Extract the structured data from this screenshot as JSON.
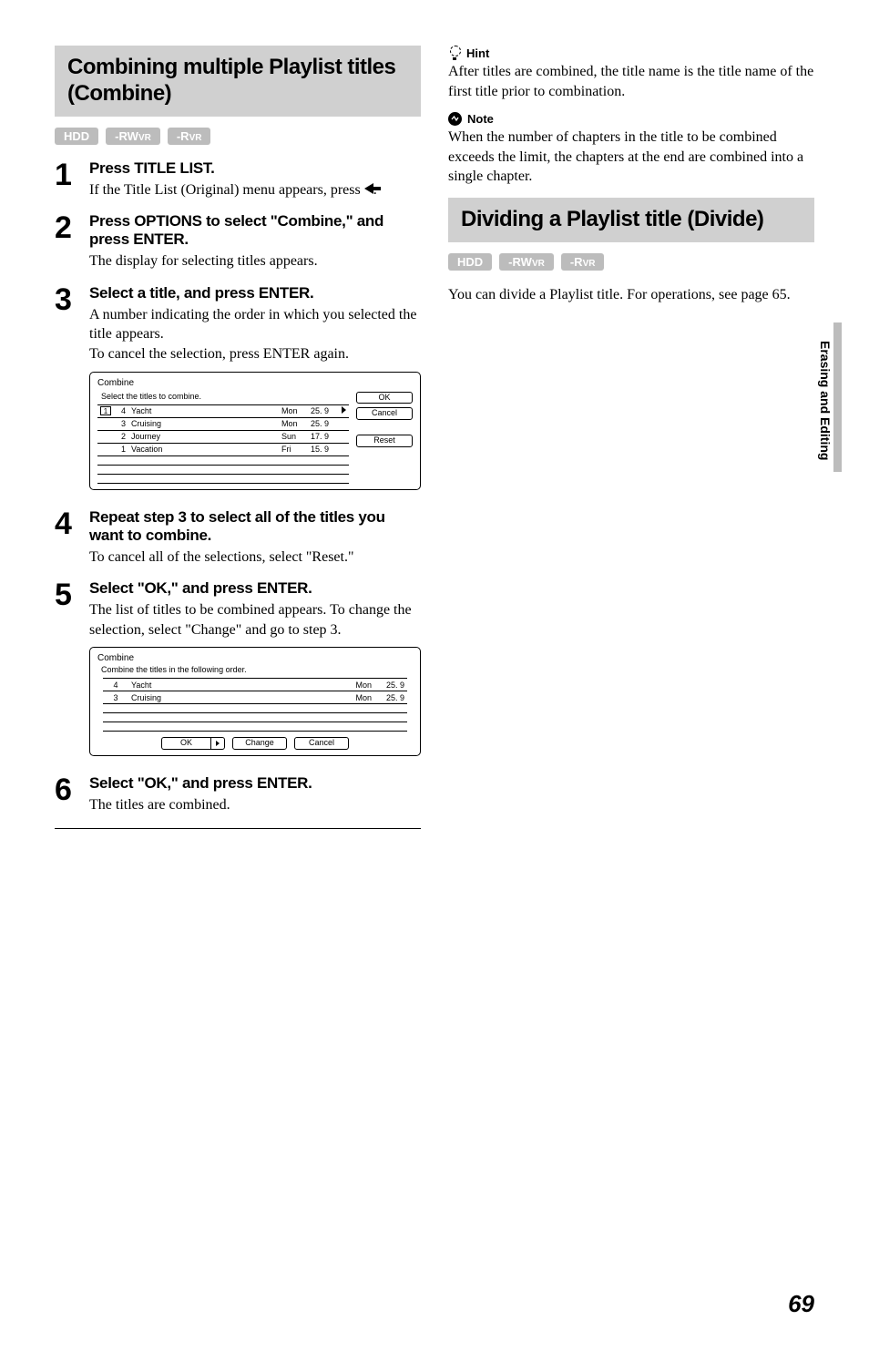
{
  "sideTab": "Erasing and Editing",
  "pageNumber": "69",
  "left": {
    "heading": "Combining multiple Playlist titles (Combine)",
    "badges": [
      {
        "main": "HDD",
        "sub": ""
      },
      {
        "main": "-RW",
        "sub": "VR"
      },
      {
        "main": "-R",
        "sub": "VR"
      }
    ],
    "steps": [
      {
        "num": "1",
        "title": "Press TITLE LIST.",
        "text_before": "If the Title List (Original) menu appears, press ",
        "text_after": "."
      },
      {
        "num": "2",
        "title": "Press OPTIONS to select \"Combine,\" and press ENTER.",
        "text": "The display for selecting titles appears."
      },
      {
        "num": "3",
        "title": "Select a title, and press ENTER.",
        "text": "A number indicating the order in which you selected the title appears.\nTo cancel the selection, press ENTER again."
      },
      {
        "num": "4",
        "title": "Repeat step 3 to select all of the titles you want to combine.",
        "text": "To cancel all of the selections, select \"Reset.\""
      },
      {
        "num": "5",
        "title": "Select \"OK,\" and press ENTER.",
        "text": "The list of titles to be combined appears. To change the selection, select \"Change\" and go to step 3."
      },
      {
        "num": "6",
        "title": "Select \"OK,\" and press ENTER.",
        "text": "The titles are combined."
      }
    ],
    "dialog1": {
      "title": "Combine",
      "sub": "Select the titles to combine.",
      "rows": [
        {
          "idx": "1",
          "no": "4",
          "name": "Yacht",
          "day": "Mon",
          "date": "25.  9",
          "arrow": true
        },
        {
          "idx": "",
          "no": "3",
          "name": "Cruising",
          "day": "Mon",
          "date": "25.  9",
          "arrow": false
        },
        {
          "idx": "",
          "no": "2",
          "name": "Journey",
          "day": "Sun",
          "date": "17.  9",
          "arrow": false
        },
        {
          "idx": "",
          "no": "1",
          "name": "Vacation",
          "day": "Fri",
          "date": "15.  9",
          "arrow": false
        }
      ],
      "buttons": [
        "OK",
        "Cancel",
        "Reset"
      ]
    },
    "dialog2": {
      "title": "Combine",
      "sub": "Combine the titles in the following order.",
      "rows": [
        {
          "no": "4",
          "name": "Yacht",
          "day": "Mon",
          "date": "25.  9"
        },
        {
          "no": "3",
          "name": "Cruising",
          "day": "Mon",
          "date": "25.  9"
        }
      ],
      "buttons": [
        "OK",
        "Change",
        "Cancel"
      ]
    }
  },
  "right": {
    "hintLabel": "Hint",
    "hintText": "After titles are combined, the title name is the title name of the first title prior to combination.",
    "noteLabel": "Note",
    "noteText": "When the number of chapters in the title to be combined exceeds the limit, the chapters at the end are combined into a single chapter.",
    "heading2": "Dividing a Playlist title (Divide)",
    "badges": [
      {
        "main": "HDD",
        "sub": ""
      },
      {
        "main": "-RW",
        "sub": "VR"
      },
      {
        "main": "-R",
        "sub": "VR"
      }
    ],
    "text2": "You can divide a Playlist title. For operations, see page 65."
  }
}
